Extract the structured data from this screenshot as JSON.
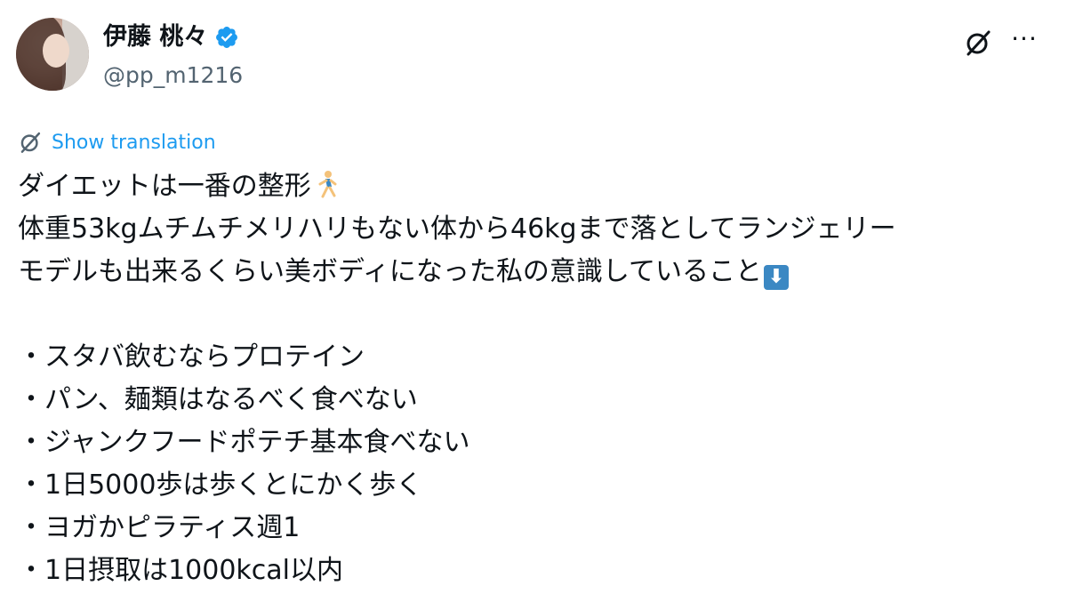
{
  "author": {
    "display_name": "伊藤 桃々",
    "handle": "@pp_m1216",
    "verified_color": "#1d9bf0"
  },
  "actions": {
    "grok_icon": "grok-icon",
    "more_label": "···"
  },
  "translation": {
    "label": "Show translation",
    "color": "#1d9bf0"
  },
  "tweet": {
    "lines": [
      "ダイエットは一番の整形",
      "体重53kgムチムチメリハリもない体から46kgまで落としてランジェリー",
      "モデルも出来るくらい美ボディになった私の意識していること",
      "",
      "・スタバ飲むならプロテイン",
      "・パン、麺類はなるべく食べない",
      "・ジャンクフードポテチ基本食べない",
      "・1日5000歩は歩くとにかく歩く",
      "・ヨガかピラティス週1",
      "・1日摂取は1000kcal以内"
    ],
    "emoji_runner": "person-running-emoji",
    "emoji_arrow": "⬇"
  }
}
